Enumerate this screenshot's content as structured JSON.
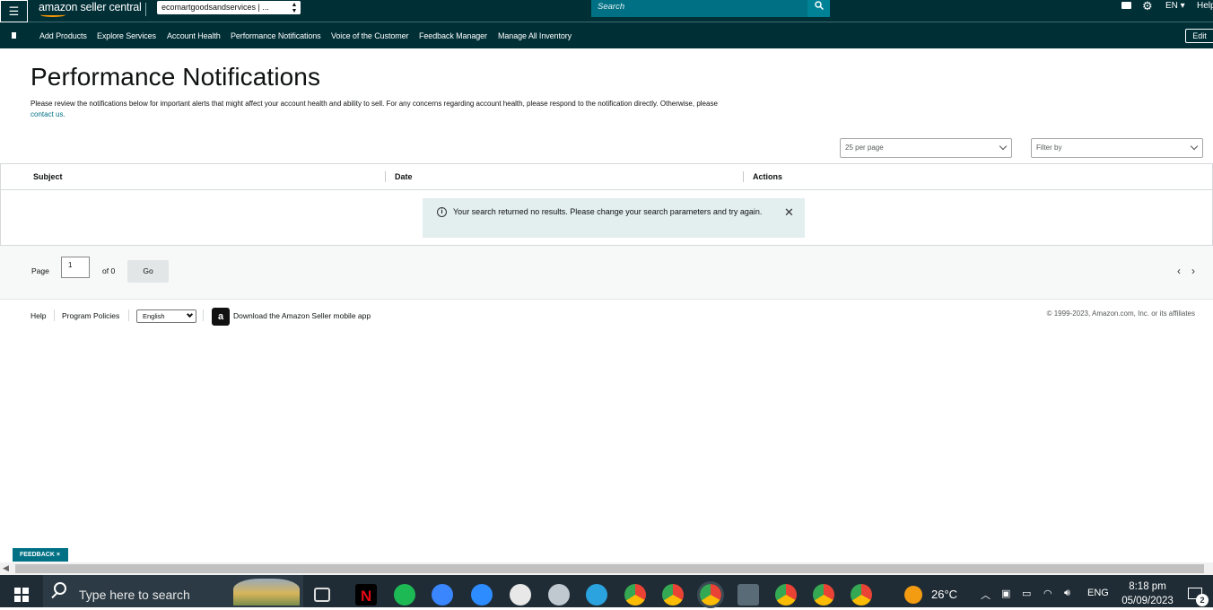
{
  "topbar": {
    "logo_text": "amazon seller central",
    "store_name": "ecomartgoodsandservices | ...",
    "search_placeholder": "Search",
    "language": "EN",
    "help_label": "Help"
  },
  "nav": {
    "items": [
      "Add Products",
      "Explore Services",
      "Account Health",
      "Performance Notifications",
      "Voice of the Customer",
      "Feedback Manager",
      "Manage All Inventory"
    ],
    "edit_label": "Edit"
  },
  "page": {
    "title": "Performance Notifications",
    "description": "Please review the notifications below for important alerts that might affect your account health and ability to sell. For any concerns regarding account health, please respond to the notification directly. Otherwise, please",
    "contact_link": "contact us.",
    "per_page": "25 per page",
    "filter_placeholder": "Filter by"
  },
  "table": {
    "columns": [
      "Subject",
      "Date",
      "Actions"
    ],
    "empty_message": "Your search returned no results. Please change your search parameters and try again."
  },
  "pagination": {
    "page_label": "Page",
    "current_page": "1",
    "of_label": "of 0",
    "go_label": "Go"
  },
  "footer": {
    "help": "Help",
    "program_policies": "Program Policies",
    "language": "English",
    "app_download": "Download the Amazon Seller mobile app",
    "copyright": "© 1999-2023, Amazon.com, Inc. or its affiliates"
  },
  "feedback_label": "FEEDBACK ×",
  "taskbar": {
    "search_text": "Type here to search",
    "temperature": "26°C",
    "lang": "ENG",
    "time": "8:18 pm",
    "date": "05/09/2023",
    "notifications": "2",
    "icon_colors": {
      "netflix": "#e50914",
      "spotify": "#1db954",
      "c_app": "#3a86ff",
      "zoom": "#2d8cff",
      "telegram": "#2aa3de",
      "chrome": "#4a90d9",
      "calculator": "#5a6b78"
    }
  }
}
